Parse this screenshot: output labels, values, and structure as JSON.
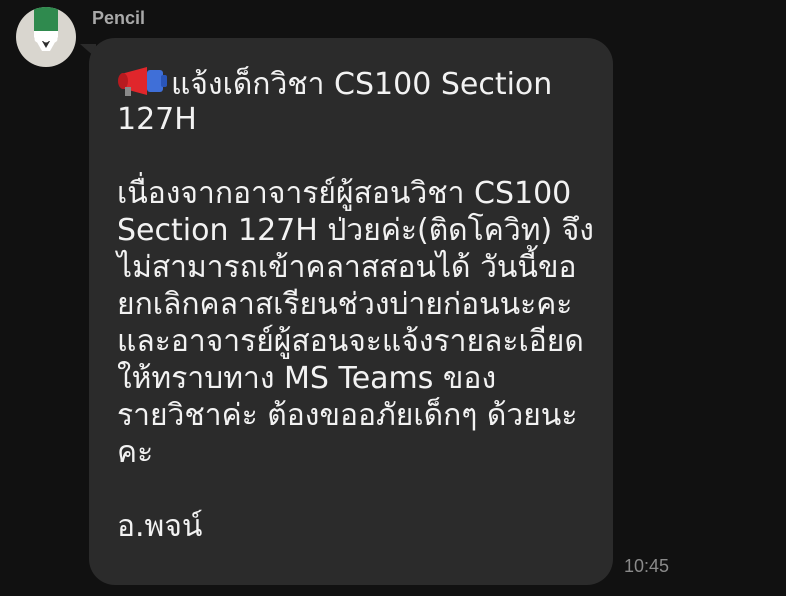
{
  "chat": {
    "sender_name": "Pencil",
    "avatar_icon": "pencil-icon",
    "message": {
      "icon": "megaphone-icon",
      "lines": [
        "แจ้งเด็กวิชา CS100 Section",
        "127H",
        "",
        "เนื่องจากอาจารย์ผู้สอนวิชา CS100",
        "Section 127H ป่วยค่ะ(ติดโควิท) จึง",
        "ไม่สามารถเข้าคลาสสอนได้  วันนี้ขอ",
        "ยกเลิกคลาสเรียนช่วงบ่ายก่อนนะคะ",
        "และอาจารย์ผู้สอนจะแจ้งรายละเอียด",
        "ให้ทราบทาง MS Teams ของ",
        "รายวิชาค่ะ ต้องขออภัยเด็กๆ ด้วยนะ",
        "คะ",
        "",
        "อ.พจน์"
      ]
    },
    "timestamp": "10:45"
  },
  "colors": {
    "background": "#111111",
    "bubble": "#2b2b2b",
    "text": "#f2f2f2",
    "sender": "#a9a9a9",
    "timestamp": "#8a8a8a"
  }
}
